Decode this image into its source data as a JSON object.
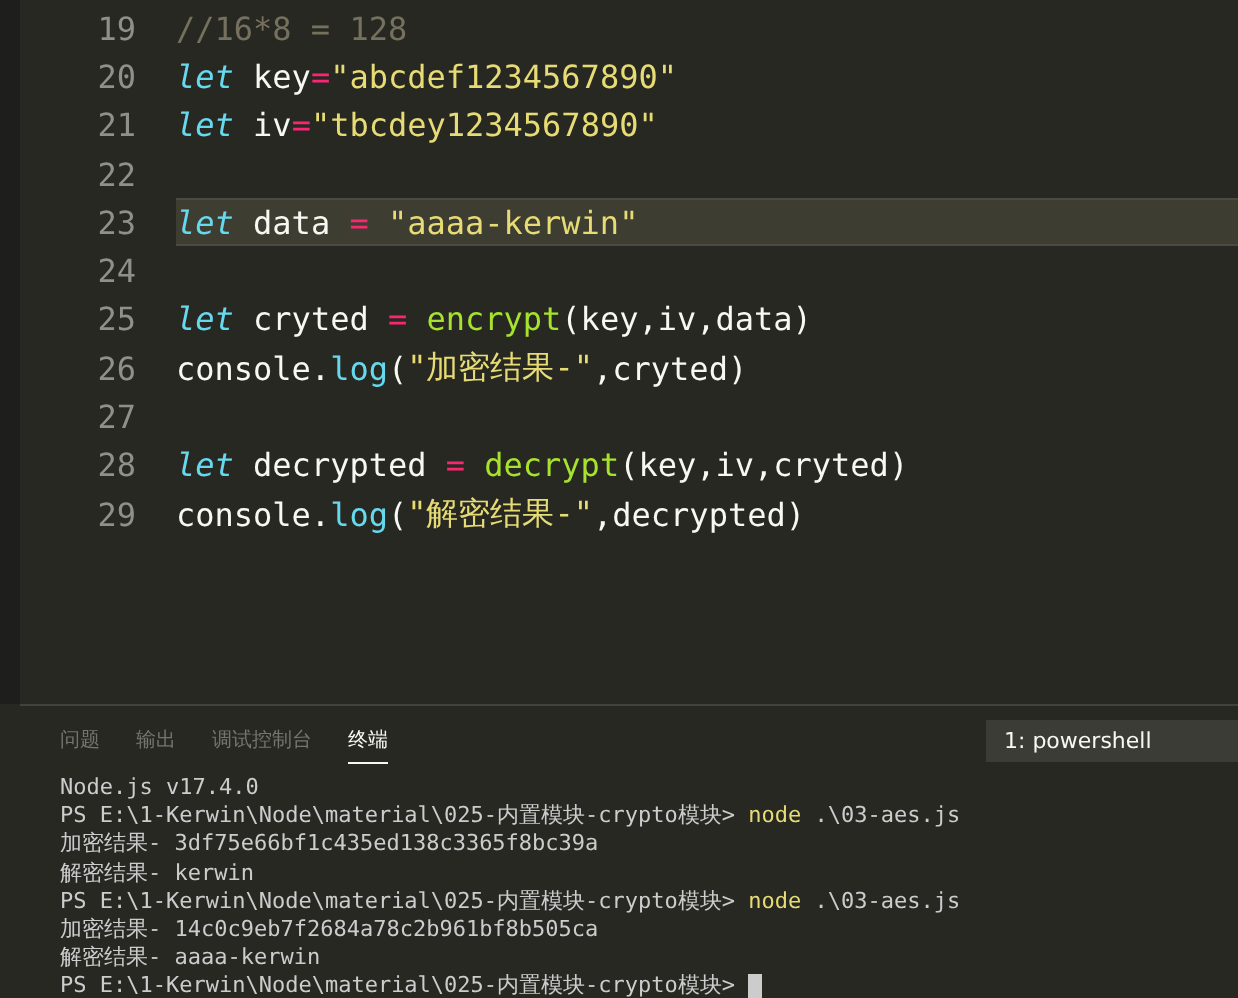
{
  "editor": {
    "lines": [
      {
        "number": "19",
        "current": false,
        "tokens": [
          {
            "kind": "comment",
            "text": "//16*8 = 128"
          }
        ]
      },
      {
        "number": "20",
        "current": false,
        "tokens": [
          {
            "kind": "keyword",
            "text": "let"
          },
          {
            "kind": "plain",
            "text": " key"
          },
          {
            "kind": "operator",
            "text": "="
          },
          {
            "kind": "string",
            "text": "\"abcdef1234567890\""
          }
        ]
      },
      {
        "number": "21",
        "current": false,
        "tokens": [
          {
            "kind": "keyword",
            "text": "let"
          },
          {
            "kind": "plain",
            "text": " iv"
          },
          {
            "kind": "operator",
            "text": "="
          },
          {
            "kind": "string",
            "text": "\"tbcdey1234567890\""
          }
        ]
      },
      {
        "number": "22",
        "current": false
      },
      {
        "number": "23",
        "current": true,
        "tokens": [
          {
            "kind": "keyword",
            "text": "let"
          },
          {
            "kind": "plain",
            "text": " data "
          },
          {
            "kind": "operator",
            "text": "= "
          },
          {
            "kind": "string",
            "text": "\"aaaa-kerwin\""
          }
        ]
      },
      {
        "number": "24",
        "current": false
      },
      {
        "number": "25",
        "current": false,
        "tokens": [
          {
            "kind": "keyword",
            "text": "let"
          },
          {
            "kind": "plain",
            "text": " cryted "
          },
          {
            "kind": "operator",
            "text": "= "
          },
          {
            "kind": "function",
            "text": "encrypt"
          },
          {
            "kind": "plain",
            "text": "(key,iv,data)"
          }
        ]
      },
      {
        "number": "26",
        "current": false,
        "tokens": [
          {
            "kind": "plain",
            "text": "console."
          },
          {
            "kind": "method",
            "text": "log"
          },
          {
            "kind": "plain",
            "text": "("
          },
          {
            "kind": "string",
            "text": "\"加密结果-\""
          },
          {
            "kind": "plain",
            "text": ",cryted)"
          }
        ]
      },
      {
        "number": "27",
        "current": false
      },
      {
        "number": "28",
        "current": false,
        "tokens": [
          {
            "kind": "keyword",
            "text": "let"
          },
          {
            "kind": "plain",
            "text": " decrypted "
          },
          {
            "kind": "operator",
            "text": "= "
          },
          {
            "kind": "function",
            "text": "decrypt"
          },
          {
            "kind": "plain",
            "text": "(key,iv,cryted)"
          }
        ]
      },
      {
        "number": "29",
        "current": false,
        "tokens": [
          {
            "kind": "plain",
            "text": "console."
          },
          {
            "kind": "method",
            "text": "log"
          },
          {
            "kind": "plain",
            "text": "("
          },
          {
            "kind": "string",
            "text": "\"解密结果-\""
          },
          {
            "kind": "plain",
            "text": ",decrypted)"
          }
        ]
      }
    ]
  },
  "panel": {
    "tabs": [
      {
        "label": "问题",
        "selected": false
      },
      {
        "label": "输出",
        "selected": false
      },
      {
        "label": "调试控制台",
        "selected": false
      },
      {
        "label": "终端",
        "selected": true
      }
    ],
    "terminal_selector": "1: powershell",
    "terminal_lines": [
      {
        "kind": "output",
        "text": "Node.js v17.4.0"
      },
      {
        "kind": "command",
        "prompt": "PS E:\\1-Kerwin\\Node\\material\\025-内置模块-crypto模块> ",
        "command": "node",
        "args": " .\\03-aes.js"
      },
      {
        "kind": "output",
        "text": "加密结果- 3df75e66bf1c435ed138c3365f8bc39a"
      },
      {
        "kind": "output",
        "text": "解密结果- kerwin"
      },
      {
        "kind": "command",
        "prompt": "PS E:\\1-Kerwin\\Node\\material\\025-内置模块-crypto模块> ",
        "command": "node",
        "args": " .\\03-aes.js"
      },
      {
        "kind": "output",
        "text": "加密结果- 14c0c9eb7f2684a78c2b961bf8b505ca"
      },
      {
        "kind": "output",
        "text": "解密结果- aaaa-kerwin"
      },
      {
        "kind": "prompt",
        "prompt": "PS E:\\1-Kerwin\\Node\\material\\025-内置模块-crypto模块> ",
        "cursor": true
      }
    ]
  }
}
